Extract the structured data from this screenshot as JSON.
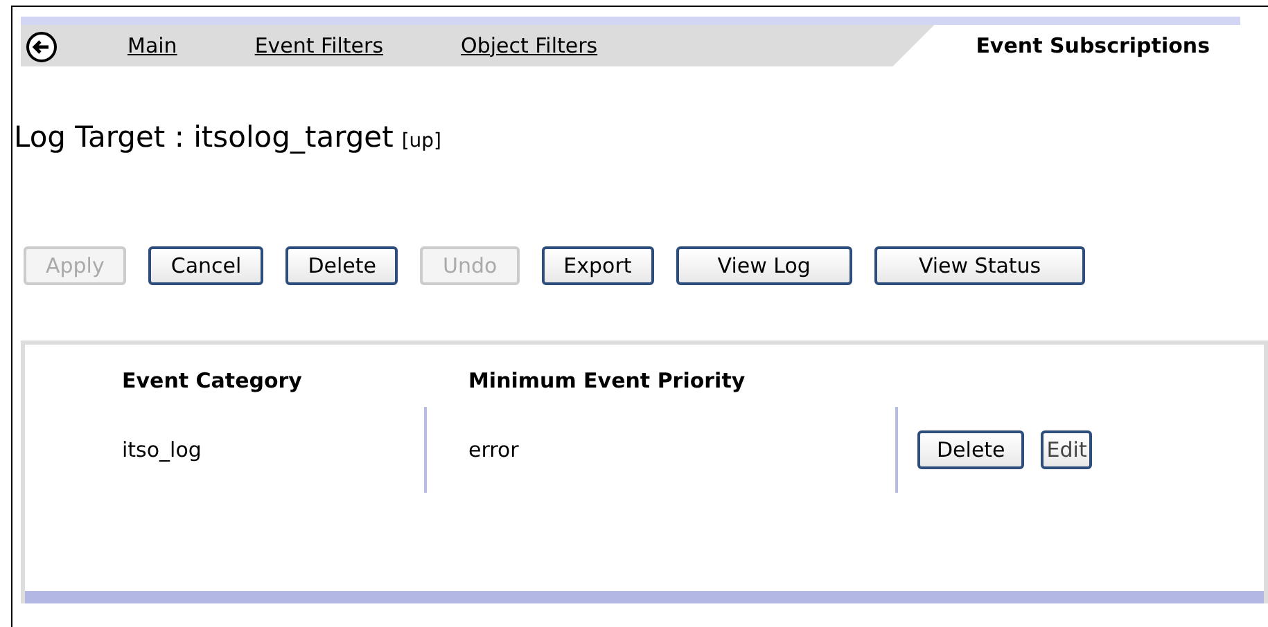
{
  "tabs": [
    {
      "label": "Main",
      "selected": false
    },
    {
      "label": "Event Filters",
      "selected": false
    },
    {
      "label": "Object Filters",
      "selected": false
    },
    {
      "label": "Event Subscriptions",
      "selected": true
    }
  ],
  "heading": {
    "label": "Log Target :",
    "name": "itsolog_target",
    "status": "[up]"
  },
  "buttons": [
    {
      "label": "Apply",
      "disabled": true
    },
    {
      "label": "Cancel",
      "disabled": false
    },
    {
      "label": "Delete",
      "disabled": false
    },
    {
      "label": "Undo",
      "disabled": true
    },
    {
      "label": "Export",
      "disabled": false
    },
    {
      "label": "View Log",
      "disabled": false
    },
    {
      "label": "View Status",
      "disabled": false
    }
  ],
  "table": {
    "columns": [
      "Event Category",
      "Minimum Event Priority"
    ],
    "rows": [
      {
        "cells": [
          "itso_log",
          "error"
        ],
        "actions": [
          "Delete",
          "Edit"
        ]
      }
    ]
  }
}
